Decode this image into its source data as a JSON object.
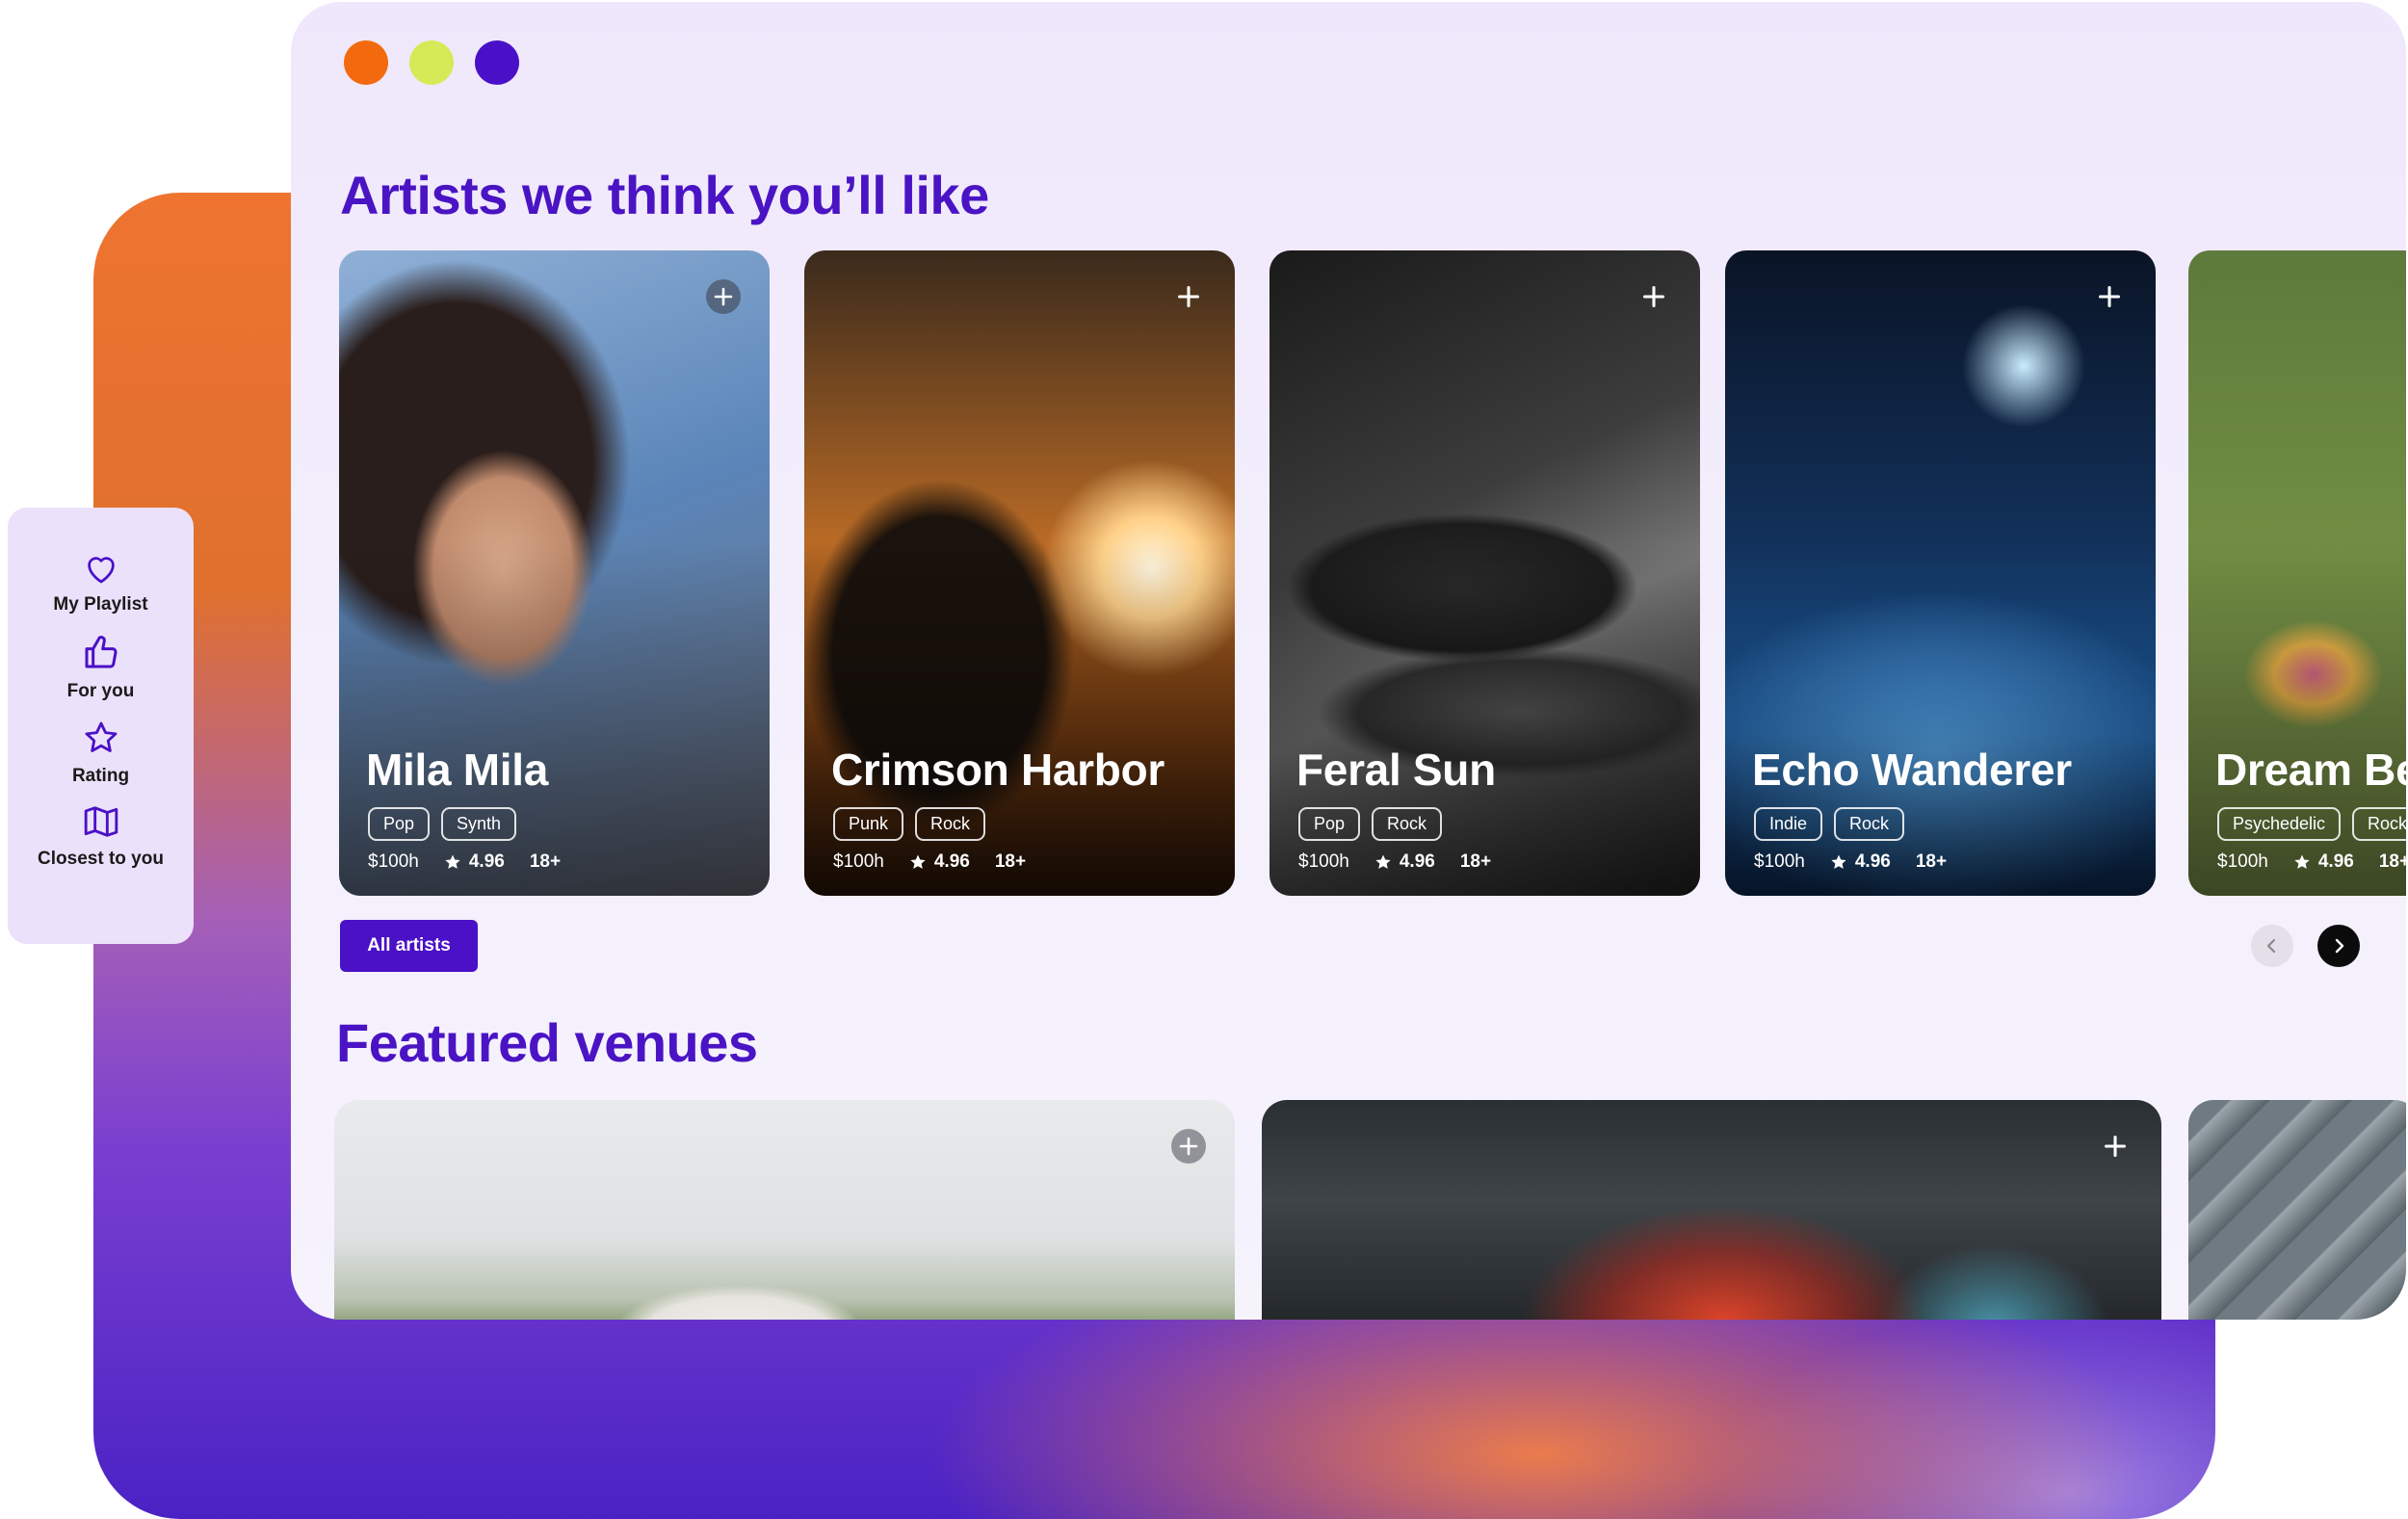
{
  "window": {
    "traffic_lights": [
      {
        "name": "close",
        "color": "#f36a0e"
      },
      {
        "name": "minimize",
        "color": "#d5ea57"
      },
      {
        "name": "maximize",
        "color": "#4a10c8"
      }
    ]
  },
  "artists_section": {
    "title": "Artists we think you’ll like",
    "all_button": "All artists",
    "cards": [
      {
        "name": "Mila Mila",
        "tags": [
          "Pop",
          "Synth"
        ],
        "price": "$100h",
        "rating": "4.96",
        "age": "18+"
      },
      {
        "name": "Crimson Harbor",
        "tags": [
          "Punk",
          "Rock"
        ],
        "price": "$100h",
        "rating": "4.96",
        "age": "18+"
      },
      {
        "name": "Feral Sun",
        "tags": [
          "Pop",
          "Rock"
        ],
        "price": "$100h",
        "rating": "4.96",
        "age": "18+"
      },
      {
        "name": "Echo Wanderer",
        "tags": [
          "Indie",
          "Rock"
        ],
        "price": "$100h",
        "rating": "4.96",
        "age": "18+"
      },
      {
        "name": "Dream Be",
        "tags": [
          "Psychedelic",
          "Rock"
        ],
        "price": "$100h",
        "rating": "4.96",
        "age": "18+"
      }
    ]
  },
  "venues_section": {
    "title": "Featured venues"
  },
  "sidebar": {
    "items": [
      {
        "label": "My Playlist",
        "icon": "heart-icon"
      },
      {
        "label": "For you",
        "icon": "thumbs-up-icon"
      },
      {
        "label": "Rating",
        "icon": "star-icon"
      },
      {
        "label": "Closest to you",
        "icon": "map-icon"
      }
    ]
  },
  "colors": {
    "accent": "#4a11c7",
    "title": "#4a14c4",
    "sidebar_bg": "#ece1fb",
    "window_bg": "#efe7fb"
  }
}
